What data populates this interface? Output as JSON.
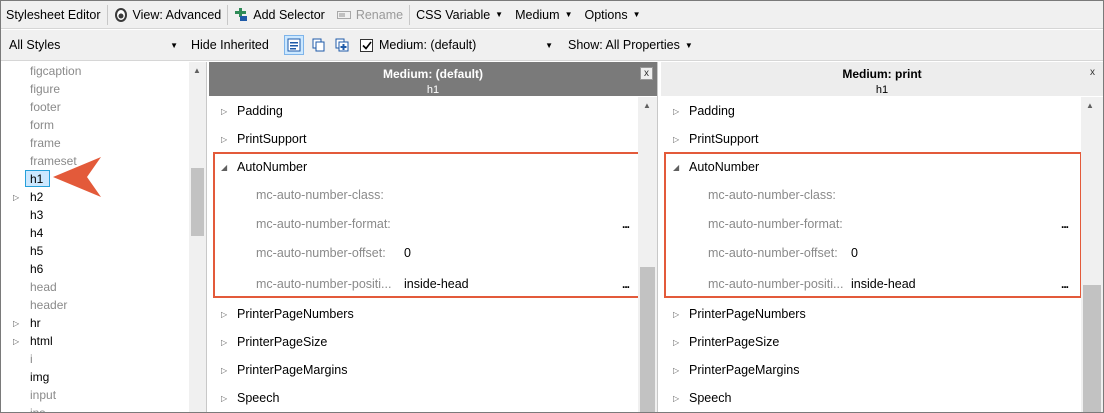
{
  "colors": {
    "highlight": "#e35a3a",
    "selection": "#cce8ff",
    "header_active": "#7a7a7a"
  },
  "toolbar1": {
    "title": "Stylesheet Editor",
    "view_label": "View: Advanced",
    "add_selector_label": "Add Selector",
    "rename_label": "Rename",
    "css_variable_label": "CSS Variable",
    "medium_label": "Medium",
    "options_label": "Options"
  },
  "toolbar2": {
    "styles_filter": "All Styles",
    "hide_inherited_label": "Hide Inherited",
    "medium_checkbox_label": "Medium: (default)",
    "medium_checked": true,
    "show_label": "Show: All Properties"
  },
  "selectors": [
    {
      "label": "figcaption",
      "style": "grey",
      "expander": false
    },
    {
      "label": "figure",
      "style": "grey",
      "expander": false
    },
    {
      "label": "footer",
      "style": "grey",
      "expander": false
    },
    {
      "label": "form",
      "style": "grey",
      "expander": false
    },
    {
      "label": "frame",
      "style": "grey",
      "expander": false
    },
    {
      "label": "frameset",
      "style": "grey",
      "expander": false
    },
    {
      "label": "h1",
      "style": "selected",
      "expander": false
    },
    {
      "label": "h2",
      "style": "normal",
      "expander": true
    },
    {
      "label": "h3",
      "style": "normal",
      "expander": false
    },
    {
      "label": "h4",
      "style": "normal",
      "expander": false
    },
    {
      "label": "h5",
      "style": "normal",
      "expander": false
    },
    {
      "label": "h6",
      "style": "normal",
      "expander": false
    },
    {
      "label": "head",
      "style": "grey",
      "expander": false
    },
    {
      "label": "header",
      "style": "grey",
      "expander": false
    },
    {
      "label": "hr",
      "style": "normal",
      "expander": true
    },
    {
      "label": "html",
      "style": "normal",
      "expander": true
    },
    {
      "label": "i",
      "style": "grey",
      "expander": false
    },
    {
      "label": "img",
      "style": "normal",
      "expander": false
    },
    {
      "label": "input",
      "style": "grey",
      "expander": false
    },
    {
      "label": "ins",
      "style": "grey",
      "expander": false
    }
  ],
  "panels": [
    {
      "title": "Medium: (default)",
      "subtitle": "h1",
      "close": "x",
      "groups": [
        "Padding",
        "PrintSupport",
        "AutoNumber",
        "PrinterPageNumbers",
        "PrinterPageSize",
        "PrinterPageMargins",
        "Speech"
      ],
      "props": [
        {
          "name": "mc-auto-number-class:",
          "value": "",
          "dots": false
        },
        {
          "name": "mc-auto-number-format:",
          "value": "",
          "dots": true
        },
        {
          "name": "mc-auto-number-offset:",
          "value": "0",
          "dots": false
        },
        {
          "name": "mc-auto-number-positi...",
          "value": "inside-head",
          "dots": true
        }
      ]
    },
    {
      "title": "Medium: print",
      "subtitle": "h1",
      "close": "x",
      "groups": [
        "Padding",
        "PrintSupport",
        "AutoNumber",
        "PrinterPageNumbers",
        "PrinterPageSize",
        "PrinterPageMargins",
        "Speech"
      ],
      "props": [
        {
          "name": "mc-auto-number-class:",
          "value": "",
          "dots": false
        },
        {
          "name": "mc-auto-number-format:",
          "value": "",
          "dots": true
        },
        {
          "name": "mc-auto-number-offset:",
          "value": "0",
          "dots": false
        },
        {
          "name": "mc-auto-number-positi...",
          "value": "inside-head",
          "dots": true
        }
      ]
    }
  ],
  "dots_label": "..."
}
